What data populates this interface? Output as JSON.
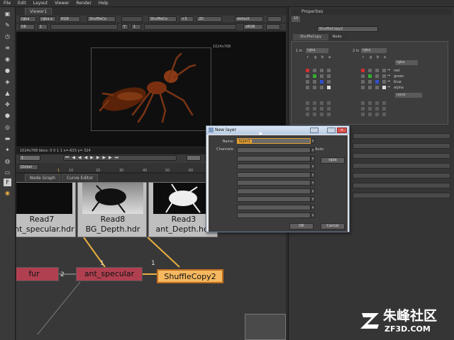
{
  "menu": [
    "File",
    "Edit",
    "Layout",
    "Viewer",
    "Render",
    "Help"
  ],
  "viewer": {
    "tab": "Viewer1",
    "ctl1": {
      "channels": "rgba",
      "alpha": "rgba.a",
      "colorspace": "RGB",
      "a_node": "ShuffleCo",
      "b_node": "ShuffleCo",
      "wipe": "+3",
      "dim": "2D",
      "lut": "default"
    },
    "ctl2": {
      "f_stop": "f/8",
      "one": "1",
      "y": "Y",
      "one_b": "1",
      "proxy": "sRGB"
    },
    "format_label": "1024x768",
    "info": "1024x768 bbox: 0 0 1 1  x=-633 y= 324"
  },
  "timeline": {
    "frame": "1",
    "fps": "fps",
    "global": "Global",
    "ticks": [
      "1",
      "10",
      "20",
      "30",
      "40",
      "50",
      "60"
    ]
  },
  "nodegraph": {
    "tabs": [
      "Node Graph",
      "Curve Editor"
    ],
    "reads": [
      {
        "l1": "Read7",
        "l2": "ant_specular.hdr"
      },
      {
        "l1": "Read8",
        "l2": "BG_Depth.hdr"
      },
      {
        "l1": "Read3",
        "l2": "ant_Depth.hdr"
      }
    ],
    "nodes": {
      "fur": "fur",
      "ant_specular": "ant_specular",
      "shuffle": "ShuffleCopy2"
    },
    "pipe_labels": {
      "a": "2",
      "b": "1",
      "c": "1"
    }
  },
  "properties": {
    "title": "Properties",
    "count": "10",
    "node_name": "ShuffleCopy2",
    "tabs": [
      "ShuffleCopy",
      "Node"
    ],
    "in1_label": "1 in",
    "in1": "rgba",
    "in2_label": "2 in",
    "in2": "rgba",
    "out_layer": "rgba",
    "none": "none",
    "col_letters": [
      "r",
      "g",
      "b",
      "a"
    ],
    "channels": [
      "red",
      "green",
      "blue",
      "alpha"
    ]
  },
  "dialog": {
    "title": "New layer",
    "name_label": "Name:",
    "name_value": "layer1",
    "channels_label": "Channels:",
    "auto_label": "Auto:",
    "auto_value": "rgba",
    "ok": "OK",
    "cancel": "Cancel"
  },
  "watermark": {
    "text": "朱峰社区",
    "url": "ZF3D.COM"
  },
  "colors": {
    "accent": "#e8b040",
    "node_red": "#b04050",
    "shuffle_fill": "#f5b860",
    "pipe": "#e8b040"
  }
}
